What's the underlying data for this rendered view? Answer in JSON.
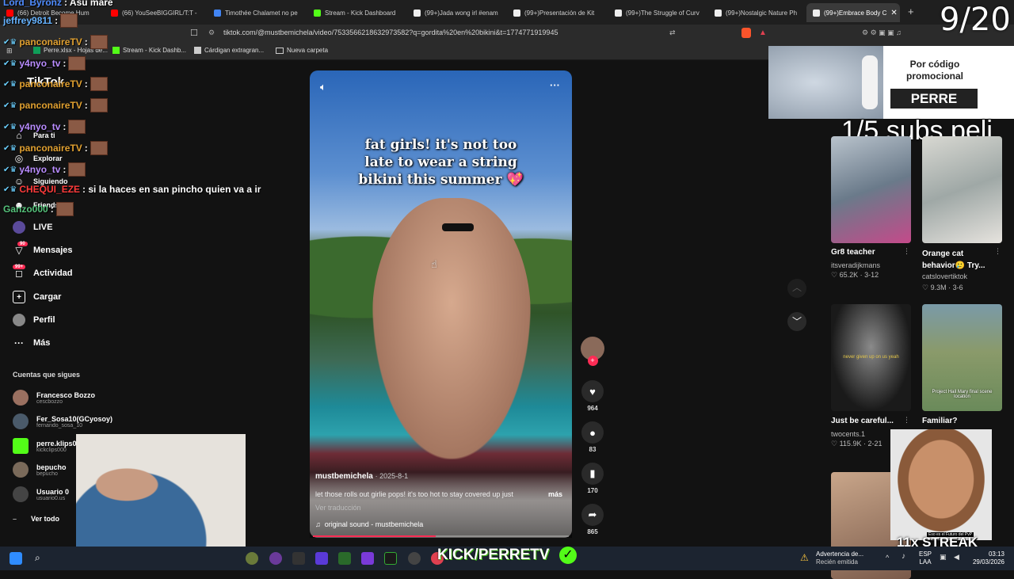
{
  "browser": {
    "tabs": [
      {
        "label": "(66) Detroit Become Hum",
        "color": "#ff0000"
      },
      {
        "label": "(66) YouSeeBIGGIRL/T:T -",
        "color": "#ff0000"
      },
      {
        "label": "Timothée Chalamet no pe",
        "color": "#4285f4"
      },
      {
        "label": "Stream - Kick Dashboard",
        "color": "#53fc18"
      },
      {
        "label": "(99+)Jada wong irl #enam",
        "color": "#ffffff"
      },
      {
        "label": "(99+)Presentación de Kit",
        "color": "#ffffff"
      },
      {
        "label": "(99+)The Struggle of Curv",
        "color": "#ffffff"
      },
      {
        "label": "(99+)Nostalgic Nature Ph",
        "color": "#ffffff"
      },
      {
        "label": "(99+)Embrace Body C",
        "color": "#ffffff"
      }
    ],
    "url": "tiktok.com/@mustbemichela/video/7533566218632973582?q=gordita%20en%20bikini&t=1774771919945",
    "bookmarks": [
      "Perre.xlsx - Hojas de...",
      "Stream - Kick Dashb...",
      "Cárdigan extragran...",
      "Nueva carpeta"
    ]
  },
  "overlay": {
    "counter": "9/20",
    "subs_text": "1/5 subs peli",
    "promo_line1": "Por código",
    "promo_line2": "promocional",
    "promo_code": "PERRE",
    "kick_name": "KICK/PERRETV",
    "streak": "11x STREAK",
    "meme_caption": "Eso es el Futuro del PvP"
  },
  "chat": [
    {
      "user": "Lord_Byronz",
      "text": ": Asu mare",
      "color": "#4f8cff"
    },
    {
      "user": "jeffrey9811",
      "text": ":",
      "color": "#66b3ff"
    },
    {
      "user": "panconaireTV",
      "text": ":",
      "color": "#e0a030"
    },
    {
      "user": "y4nyo_tv",
      "text": ":",
      "color": "#b98cff"
    },
    {
      "user": "panconaireTV",
      "text": ":",
      "color": "#e0a030"
    },
    {
      "user": "panconaireTV",
      "text": ":",
      "color": "#e0a030"
    },
    {
      "user": "y4nyo_tv",
      "text": ":",
      "color": "#b98cff"
    },
    {
      "user": "panconaireTV",
      "text": ":",
      "color": "#e0a030"
    },
    {
      "user": "y4nyo_tv",
      "text": ":",
      "color": "#b98cff"
    },
    {
      "user": "CHEQUI_EZE",
      "text": ": si la haces en san pincho quien va a ir",
      "color": "#ff3b3b"
    },
    {
      "user": "Ganzo000",
      "text": ":",
      "color": "#55c27a"
    }
  ],
  "sidebar": {
    "logo": "TikTok",
    "nav": [
      {
        "label": "Para ti",
        "icon": "home-icon"
      },
      {
        "label": "Explorar",
        "icon": "compass-icon"
      },
      {
        "label": "Siguiendo",
        "icon": "following-icon"
      },
      {
        "label": "Friends",
        "icon": "friends-icon"
      },
      {
        "label": "LIVE",
        "icon": "live-icon"
      },
      {
        "label": "Mensajes",
        "icon": "message-icon",
        "badge": "90"
      },
      {
        "label": "Actividad",
        "icon": "activity-icon",
        "badge": "99+"
      },
      {
        "label": "Cargar",
        "icon": "upload-icon"
      },
      {
        "label": "Perfil",
        "icon": "profile-icon"
      },
      {
        "label": "Más",
        "icon": "more-icon"
      }
    ],
    "following_header": "Cuentas que sigues",
    "following": [
      {
        "name": "Francesco Bozzo",
        "handle": "cescbozzo"
      },
      {
        "name": "Fer_Sosa10(GCyosoy)",
        "handle": "fernando_sosa_10"
      },
      {
        "name": "perre.klips0",
        "handle": "kickclips000"
      },
      {
        "name": "bepucho",
        "handle": "bepucho"
      },
      {
        "name": "Usuario 0",
        "handle": "usuario0.us"
      }
    ],
    "see_all": "Ver todo"
  },
  "video": {
    "overlay_text": [
      "fat girls! it's not too",
      "late to wear a string",
      "bikini this summer 💖"
    ],
    "author": "mustbemichela",
    "date": "· 2025-8-1",
    "description": "let those rolls out girlie pops! it's too hot to stay covered up just",
    "more": "más",
    "translate": "Ver traducción",
    "sound": "original sound - mustbemichela",
    "progress": 0.48,
    "likes": "964",
    "comments": "83",
    "saves": "170",
    "shares": "865"
  },
  "recommendations": [
    {
      "title": "Gr8 teacher",
      "author": "itsveradijkmans",
      "likes": "65.2K",
      "date": "· 3-12"
    },
    {
      "title": "Orange cat behavior🥲 Try...",
      "author": "catslovertiktok",
      "likes": "9.3M",
      "date": "· 3-6"
    },
    {
      "title": "Just be careful...",
      "author": "twocents.1",
      "likes": "115.9K",
      "date": "· 2-21"
    },
    {
      "title": "Familiar?",
      "author": "",
      "likes": "",
      "date": ""
    }
  ],
  "thumb_texts": [
    "never given up on us yeah",
    "Project Hail Mary final scene location"
  ],
  "taskbar": {
    "notification_title": "Advertencia de...",
    "notification_sub": "Recién emitida",
    "lang": "ESP",
    "lang2": "LAA",
    "time": "03:13",
    "date": "29/03/2026"
  }
}
